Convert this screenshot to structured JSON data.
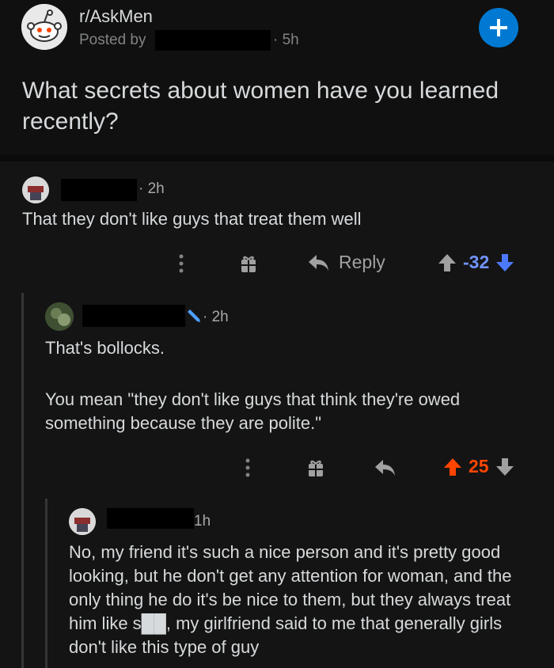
{
  "post": {
    "subreddit": "r/AskMen",
    "posted_by": "Posted by",
    "time": "5h",
    "title": "What secrets about women have you learned recently?"
  },
  "comments": [
    {
      "time": "2h",
      "text": "That they don't like guys that treat them well",
      "reply_label": "Reply",
      "score": "-32"
    },
    {
      "time": "2h",
      "paragraphs": [
        "That's bollocks.",
        "You mean \"they don't like guys that think they're owed something because they are polite.\""
      ],
      "score": "25"
    },
    {
      "time": "1h",
      "text": "No, my friend it's such a nice person and it's pretty good looking, but he don't get any attention for woman, and the only thing he do it's be nice to them, but they always treat him like s██, my girlfriend said to me that generally girls don't like this type of guy"
    }
  ],
  "colors": {
    "background": "#141414",
    "downvote_blue": "#7193ff",
    "upvote_orange": "#ff4500",
    "plus_blue": "#0079d3"
  },
  "icons": [
    "reddit-snoo-icon",
    "plus-icon",
    "more-dots-icon",
    "gift-icon",
    "reply-arrow-icon",
    "upvote-arrow-icon",
    "downvote-arrow-icon",
    "pencil-icon"
  ]
}
